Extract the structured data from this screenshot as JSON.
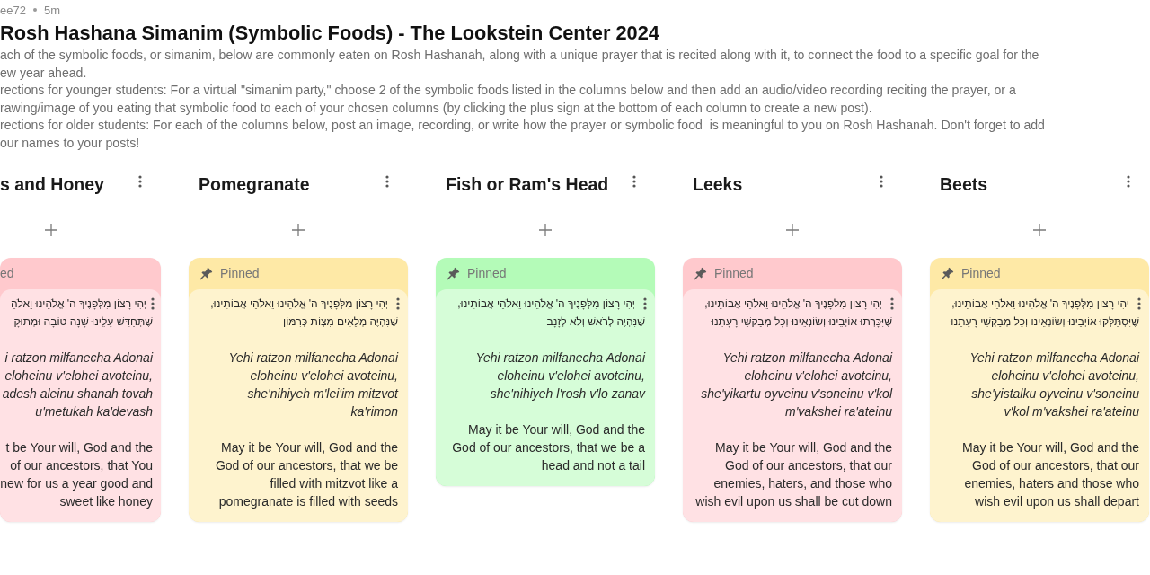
{
  "meta": {
    "author": "ee72",
    "time": "5m"
  },
  "title": "Rosh Hashana Simanim (Symbolic Foods) - The Lookstein Center 2024",
  "description": [
    "ach of the symbolic foods, or simanim, below are commonly eaten on Rosh Hashanah, along with a unique prayer that is recited along with it, to connect the food to a specific goal for the\new year ahead.",
    "rections for younger students: For a virtual \"simanim party,\" choose 2 of the symbolic foods listed in the columns below and then add an audio/video recording reciting the prayer, or a\nrawing/image of you eating that symbolic food to each of your chosen columns (by clicking the plus sign at the bottom of each column to create a new post).",
    "rections for older students: For each of the columns below, post an image, recording, or write how the prayer or symbolic food  is meaningful to you on Rosh Hashanah. Don't forget to add\nour names to your posts!"
  ],
  "columns": [
    {
      "title": "s and Honey",
      "clipped": true,
      "cards": [
        {
          "pin_label": "ed",
          "color": "#ffc9cd",
          "hebrew": "יְהִי רָצוֹן מִלְּפָנֶיךָ ה' אֱלֹהֵינוּ וֵאלֹהֵ\nשֶׁתְּחַדֵּשׁ עָלֵינוּ שָׁנָה טוֹבָה וּמְתוּקָ",
          "transliteration": "i ratzon milfanecha Adonai\neloheinu v'elohei avoteinu,\nadesh aleinu shanah tovah\nu'metukah ka'devash",
          "english": "t be Your will, God and the\nof our ancestors, that You\nnew for us a year good and\nsweet like honey"
        }
      ]
    },
    {
      "title": "Pomegranate",
      "clipped": false,
      "cards": [
        {
          "pin_label": "Pinned",
          "color": "#fee9a6",
          "hebrew": "יְהִי רָצוֹן מִלְּפָנֶיךָ ה' אֱלֹהֵינוּ וֵאלֹהֵי אֲבוֹתֵינוּ,\nשֶׁנִּהְיֶה מְלֵאִים מִצְוֹת כְּרִמּוֹן",
          "transliteration": "Yehi ratzon milfanecha Adonai\neloheinu v'elohei avoteinu,\nshe'nihiyeh m'lei'im mitzvot\nka'rimon",
          "english": "May it be Your will, God and the\nGod of our ancestors, that we be\nfilled with mitzvot like a\npomegranate is filled with seeds"
        }
      ]
    },
    {
      "title": "Fish or Ram's Head",
      "clipped": false,
      "cards": [
        {
          "pin_label": "Pinned",
          "color": "#b4fbb8",
          "hebrew": "יְהִי רָצוֹן מִלְּפָנֶיךָ ה' אֱלֹהֵינוּ וֵאלֹהֵי אֲבוֹתֵינוּ,\nשֶׁנִּהְיֶה לְרֹאשׁ וְלֹא לְזָנָב",
          "transliteration": "Yehi ratzon milfanecha Adonai\neloheinu v'elohei avoteinu,\nshe'nihiyeh l'rosh v'lo zanav",
          "english": "May it be Your will, God and the\nGod of our ancestors, that we be a\nhead and not a tail"
        }
      ]
    },
    {
      "title": "Leeks",
      "clipped": false,
      "cards": [
        {
          "pin_label": "Pinned",
          "color": "#ffc9cd",
          "hebrew": "יְהִי רָצוֹן מִלְּפָנֶיךָ ה' אֱלֹהֵינוּ וֵאלֹהֵי אֲבוֹתֵינוּ,\nשֶׁיִּכָּרְתוּ אוֹיְבֵינוּ וְשׂוֹנְאֵינוּ וְכָל מְבַקְשֵׁי רָעָתֵנוּ",
          "transliteration": "Yehi ratzon milfanecha Adonai\neloheinu v'elohei avoteinu,\nshe'yikartu oyveinu v'soneinu v'kol\nm'vakshei ra'ateinu",
          "english": "May it be Your will, God and the\nGod of our ancestors, that our\nenemies, haters, and those who\nwish evil upon us shall be cut down"
        }
      ]
    },
    {
      "title": "Beets",
      "clipped": false,
      "cards": [
        {
          "pin_label": "Pinned",
          "color": "#fee9a6",
          "hebrew": "יְהִי רָצוֹן מִלְּפָנֶיךָ ה' אֱלֹהֵינוּ וֵאלֹהֵי אֲבוֹתֵינוּ,\nשֶׁיִּסְתַּלְּקוּ אוֹיְבֵינוּ וְשׂוֹנְאֵינוּ וְכָל מְבַקְשֵׁי רָעָתֵנוּ",
          "transliteration": "Yehi ratzon milfanecha Adonai\neloheinu v'elohei avoteinu,\nshe'yistalku oyveinu v'soneinu\nv'kol m'vakshei ra'ateinu",
          "english": "May it be Your will, God and the\nGod of our ancestors, that our\nenemies, haters and those who\nwish evil upon us shall depart"
        }
      ]
    }
  ]
}
